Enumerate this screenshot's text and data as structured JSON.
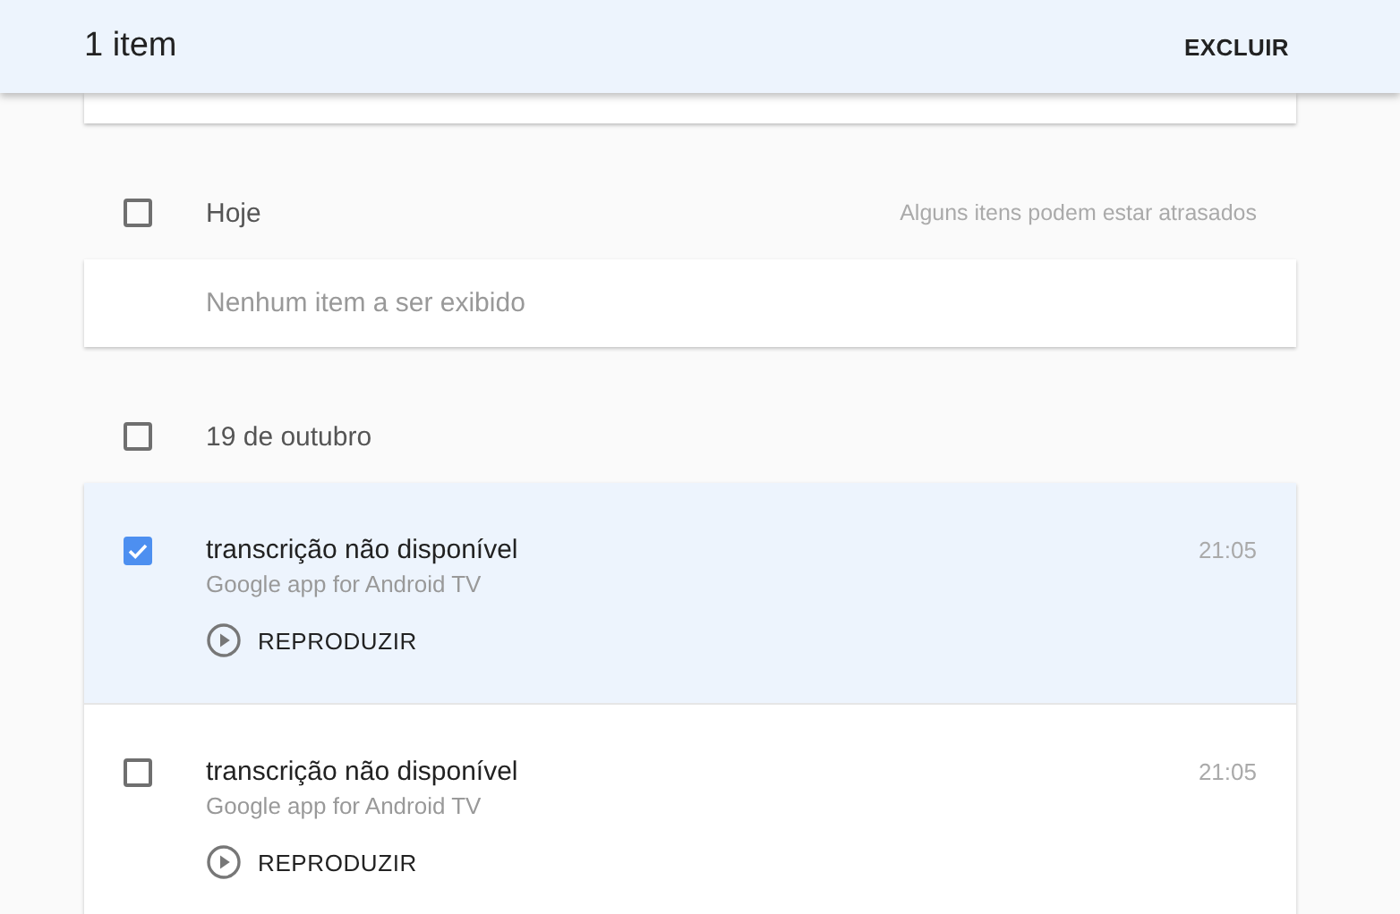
{
  "header": {
    "count": "1 item",
    "action": "EXCLUIR"
  },
  "sections": [
    {
      "title": "Hoje",
      "checked": false,
      "note": "Alguns itens podem estar atrasados",
      "empty_message": "Nenhum item a ser exibido"
    },
    {
      "title": "19 de outubro",
      "checked": false,
      "items": [
        {
          "title": "transcrição não disponível",
          "source": "Google app for Android TV",
          "time": "21:05",
          "play_label": "REPRODUZIR",
          "selected": true,
          "checked": true
        },
        {
          "title": "transcrição não disponível",
          "source": "Google app for Android TV",
          "time": "21:05",
          "play_label": "REPRODUZIR",
          "selected": false,
          "checked": false
        }
      ]
    }
  ]
}
